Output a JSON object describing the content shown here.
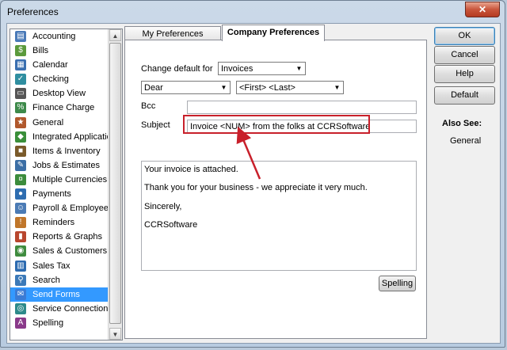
{
  "window": {
    "title": "Preferences",
    "close_glyph": "✕"
  },
  "categories": [
    {
      "label": "Accounting",
      "icon": "accounting-icon",
      "color": "#4a7ab8",
      "glyph": "▤"
    },
    {
      "label": "Bills",
      "icon": "bills-icon",
      "color": "#5b9a3c",
      "glyph": "$"
    },
    {
      "label": "Calendar",
      "icon": "calendar-icon",
      "color": "#3a6fb0",
      "glyph": "▦"
    },
    {
      "label": "Checking",
      "icon": "checking-icon",
      "color": "#2f8ea0",
      "glyph": "✓"
    },
    {
      "label": "Desktop View",
      "icon": "desktop-view-icon",
      "color": "#555555",
      "glyph": "▭"
    },
    {
      "label": "Finance Charge",
      "icon": "finance-charge-icon",
      "color": "#3d8a4a",
      "glyph": "%"
    },
    {
      "label": "General",
      "icon": "general-icon",
      "color": "#b0582c",
      "glyph": "★"
    },
    {
      "label": "Integrated Applications",
      "icon": "integrated-apps-icon",
      "color": "#3a8f3a",
      "glyph": "◆"
    },
    {
      "label": "Items & Inventory",
      "icon": "items-inventory-icon",
      "color": "#7a5a2a",
      "glyph": "■"
    },
    {
      "label": "Jobs & Estimates",
      "icon": "jobs-estimates-icon",
      "color": "#3b6ea5",
      "glyph": "✎"
    },
    {
      "label": "Multiple Currencies",
      "icon": "currencies-icon",
      "color": "#3c8c3c",
      "glyph": "¤"
    },
    {
      "label": "Payments",
      "icon": "payments-icon",
      "color": "#2e6db0",
      "glyph": "●"
    },
    {
      "label": "Payroll & Employees",
      "icon": "payroll-icon",
      "color": "#4b7bb5",
      "glyph": "☺"
    },
    {
      "label": "Reminders",
      "icon": "reminders-icon",
      "color": "#c0762a",
      "glyph": "!"
    },
    {
      "label": "Reports & Graphs",
      "icon": "reports-graphs-icon",
      "color": "#b8462e",
      "glyph": "▮"
    },
    {
      "label": "Sales & Customers",
      "icon": "sales-customers-icon",
      "color": "#3f8c3f",
      "glyph": "◉"
    },
    {
      "label": "Sales Tax",
      "icon": "sales-tax-icon",
      "color": "#2d6bb0",
      "glyph": "▥"
    },
    {
      "label": "Search",
      "icon": "search-icon",
      "color": "#3b79b8",
      "glyph": "⚲"
    },
    {
      "label": "Send Forms",
      "icon": "send-forms-icon",
      "color": "#3a7bd5",
      "glyph": "✉",
      "selected": true
    },
    {
      "label": "Service Connection",
      "icon": "service-connection-icon",
      "color": "#2d8a8a",
      "glyph": "◎"
    },
    {
      "label": "Spelling",
      "icon": "spelling-icon",
      "color": "#8a3a8a",
      "glyph": "A"
    }
  ],
  "tabs": {
    "my_preferences": "My Preferences",
    "company_preferences": "Company Preferences"
  },
  "form": {
    "change_default_label": "Change default for",
    "change_default_value": "Invoices",
    "salutation_value": "Dear",
    "name_format_value": "<First> <Last>",
    "bcc_label": "Bcc",
    "bcc_value": "",
    "subject_label": "Subject",
    "subject_value": "Invoice <NUM> from the folks at CCRSoftware",
    "body_lines": [
      "Your invoice is attached.",
      "Thank you for your business - we appreciate it very much.",
      "Sincerely,",
      "CCRSoftware"
    ],
    "spelling_button": "Spelling"
  },
  "buttons": {
    "ok": "OK",
    "cancel": "Cancel",
    "help": "Help",
    "default": "Default"
  },
  "see_also": {
    "title": "Also See:",
    "items": [
      "General"
    ]
  },
  "scroll": {
    "up_glyph": "▲",
    "down_glyph": "▼"
  },
  "dropdown_glyph": "▼",
  "colors": {
    "selection": "#3399ff",
    "annotation": "#c8202b"
  }
}
